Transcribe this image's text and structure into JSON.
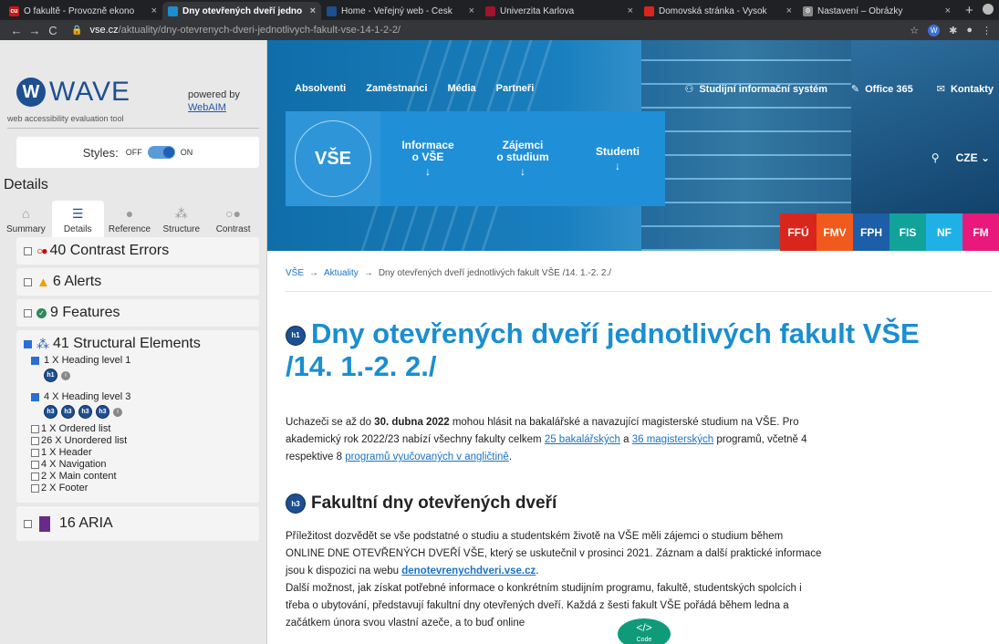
{
  "browser": {
    "tabs": [
      {
        "title": "O fakultě - Provozně ekono",
        "fav_color": "#c41a1a",
        "fav_text": "cu",
        "active": false
      },
      {
        "title": "Dny otevřených dveří jedno",
        "fav_color": "#1a8ed0",
        "fav_text": "",
        "active": true
      },
      {
        "title": "Home - Veřejný web - Česk",
        "fav_color": "#1d4f91",
        "fav_text": "",
        "active": false
      },
      {
        "title": "Univerzita Karlova",
        "fav_color": "#a0142c",
        "fav_text": "",
        "active": false
      },
      {
        "title": "Domovská stránka - Vysok",
        "fav_color": "#d8261f",
        "fav_text": "",
        "active": false
      },
      {
        "title": "Nastavení – Obrázky",
        "fav_color": "#888888",
        "fav_text": "",
        "active": false
      }
    ],
    "url_host": "vse.cz",
    "url_path": "/aktuality/dny-otevrenych-dveri-jednotlivych-fakult-vse-14-1-2-2/"
  },
  "wave": {
    "logo_text": "WAVE",
    "subtitle": "web accessibility evaluation tool",
    "powered_by": "powered by",
    "webaim": "WebAIM",
    "styles_label": "Styles:",
    "off": "OFF",
    "on": "ON",
    "details_title": "Details",
    "tabs": [
      "Summary",
      "Details",
      "Reference",
      "Structure",
      "Contrast"
    ],
    "contrast_errors": "40 Contrast Errors",
    "alerts": "6 Alerts",
    "features": "9 Features",
    "structural": "41 Structural Elements",
    "heading1": "1 X Heading level 1",
    "heading3": "4 X Heading level 3",
    "list": [
      "1 X Ordered list",
      "26 X Unordered list",
      "1 X Header",
      "4 X Navigation",
      "2 X Main content",
      "2 X Footer"
    ],
    "aria": "16 ARIA",
    "badge_h1": "h1",
    "badge_h3": "h3"
  },
  "site": {
    "topnav": [
      "Absolventi",
      "Zaměstnanci",
      "Média",
      "Partneři"
    ],
    "topright": [
      "Studijní informační systém",
      "Office 365",
      "Kontakty"
    ],
    "logo_text": "VŠE",
    "menu": [
      {
        "label1": "Informace",
        "label2": "o VŠE"
      },
      {
        "label1": "Zájemci",
        "label2": "o studium"
      },
      {
        "label1": "Studenti",
        "label2": ""
      }
    ],
    "lang": "CZE",
    "faculties": [
      {
        "name": "FFÚ",
        "color": "#d9261c"
      },
      {
        "name": "FMV",
        "color": "#f05a1c"
      },
      {
        "name": "FPH",
        "color": "#1d5ea8"
      },
      {
        "name": "FIS",
        "color": "#11a39a"
      },
      {
        "name": "NF",
        "color": "#1fb0e6"
      },
      {
        "name": "FM",
        "color": "#e8197a"
      }
    ],
    "crumbs": [
      "VŠE",
      "Aktuality",
      "Dny otevřených dveří jednotlivých fakult VŠE /14. 1.-2. 2./"
    ],
    "h1": "Dny otevřených dveří jednotlivých fakult VŠE /14. 1.-2. 2./",
    "p1_a": "Uchazeči se až do ",
    "p1_b": "30. dubna 2022",
    "p1_c": " mohou hlásit na bakalářské a navazující magisterské studium na VŠE. Pro akademický rok 2022/23 nabízí všechny fakulty celkem ",
    "p1_link1": "25 bakalářských",
    "p1_d": " a ",
    "p1_link2": "36 magisterských",
    "p1_e": " programů, včetně 4 respektive 8 ",
    "p1_link3": "programů vyučovaných v angličtině",
    "p1_f": ".",
    "h3": "Fakultní dny otevřených dveří",
    "p2_a": "Příležitost dozvědět se vše podstatné o studiu a studentském životě na VŠE měli zájemci o studium během ONLINE DNE OTEVŘENÝCH DVEŘÍ VŠE, který se uskutečnil v prosinci 2021. Záznam a další praktické informace jsou k dispozici na webu ",
    "p2_link": "denotevrenychdveri.vse.cz",
    "p2_b": ".",
    "p3": "Další možnost, jak získat potřebné informace o konkrétním studijním programu, fakultě, studentských spolcích i třeba o ubytování, představují fakultní dny otevřených dveří. Každá z šesti fakult VŠE pořádá během ledna a začátkem února svou vlastní ",
    "p3_tail": "azeče, a to buď online",
    "code_label": "</>",
    "code_sub": "Code"
  }
}
